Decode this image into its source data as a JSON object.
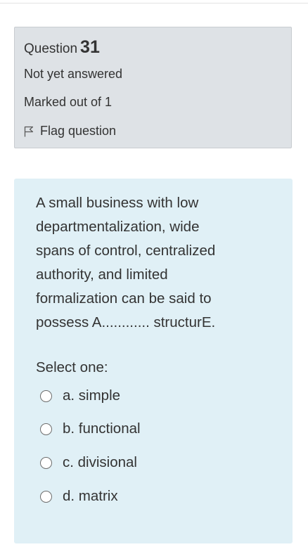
{
  "info": {
    "question_label": "Question",
    "question_number": "31",
    "state": "Not yet answered",
    "grade": "Marked out of 1",
    "flag_label": "Flag question"
  },
  "question": {
    "text_lines": [
      "A small business with low",
      "departmentalization, wide",
      "spans of control, centralized",
      "authority, and limited",
      "formalization can be said to",
      "possess A............ structurE."
    ],
    "prompt": "Select one:",
    "answers": [
      {
        "label": "a. simple",
        "selected": false
      },
      {
        "label": "b. functional",
        "selected": false
      },
      {
        "label": "c. divisional",
        "selected": false
      },
      {
        "label": "d. matrix",
        "selected": false
      }
    ]
  },
  "colors": {
    "info_panel_bg": "#dee2e6",
    "content_panel_bg": "#e0f0f6",
    "text": "#333333"
  },
  "icons": {
    "flag": "flag-outline-icon",
    "radio": "radio-unchecked-icon"
  }
}
